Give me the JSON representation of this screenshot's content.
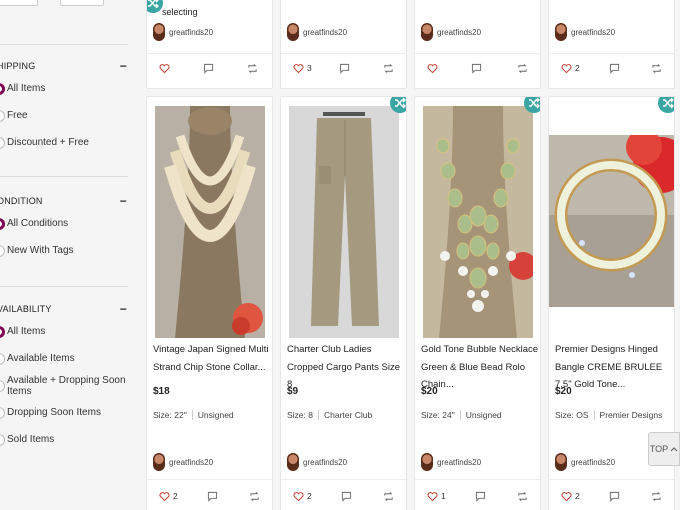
{
  "sidebar": {
    "shipping": {
      "heading": "HIPPING",
      "collapse": "−",
      "options": [
        "All Items",
        "Free",
        "Discounted + Free"
      ]
    },
    "condition": {
      "heading": "ONDITION",
      "collapse": "−",
      "options": [
        "All Conditions",
        "New With Tags"
      ]
    },
    "availability": {
      "heading": "VAILABILITY",
      "collapse": "−",
      "options": [
        "All Items",
        "Available Items",
        "Available + Dropping Soon Items",
        "Dropping Soon Items",
        "Sold Items"
      ]
    }
  },
  "top_row": [
    {
      "fragment": "selecting",
      "seller": "greatfinds20",
      "likes": ""
    },
    {
      "seller": "greatfinds20",
      "likes": "3"
    },
    {
      "seller": "greatfinds20",
      "likes": ""
    },
    {
      "seller": "greatfinds20",
      "likes": "2"
    }
  ],
  "listings": [
    {
      "title": "Vintage Japan Signed Multi Strand Chip Stone Collar...",
      "price": "$18",
      "size": "Size: 22\"",
      "brand": "Unsigned",
      "seller": "greatfinds20",
      "likes": "2"
    },
    {
      "title": "Charter Club Ladies Cropped Cargo Pants Size 8",
      "price": "$9",
      "size": "Size: 8",
      "brand": "Charter Club",
      "seller": "greatfinds20",
      "likes": "2"
    },
    {
      "title": "Gold Tone Bubble Necklace Green & Blue Bead Rolo Chain...",
      "price": "$20",
      "size": "Size: 24\"",
      "brand": "Unsigned",
      "seller": "greatfinds20",
      "likes": "1"
    },
    {
      "title": "Premier Designs Hinged Bangle CREME BRULEE 7.5\" Gold Tone...",
      "price": "$20",
      "size": "Size: OS",
      "brand": "Premier Designs",
      "seller": "greatfinds20",
      "likes": "2"
    }
  ],
  "floating": {
    "top_label": "TOP"
  },
  "colors": {
    "accent": "#7f0353",
    "shuffle": "#3aa6a3",
    "heart": "#c0392b"
  }
}
